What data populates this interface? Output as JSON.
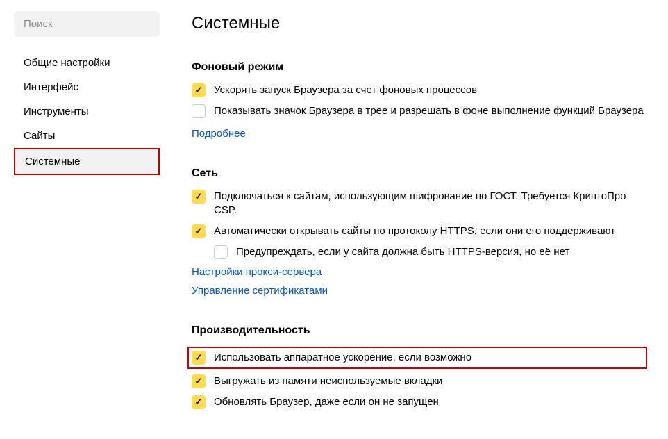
{
  "sidebar": {
    "search_placeholder": "Поиск",
    "items": [
      {
        "label": "Общие настройки"
      },
      {
        "label": "Интерфейс"
      },
      {
        "label": "Инструменты"
      },
      {
        "label": "Сайты"
      },
      {
        "label": "Системные"
      }
    ]
  },
  "page": {
    "title": "Системные"
  },
  "sections": {
    "background": {
      "title": "Фоновый режим",
      "opt1": "Ускорять запуск Браузера за счет фоновых процессов",
      "opt2": "Показывать значок Браузера в трее и разрешать в фоне выполнение функций Браузера",
      "more_link": "Подробнее"
    },
    "network": {
      "title": "Сеть",
      "opt1": "Подключаться к сайтам, использующим шифрование по ГОСТ. Требуется КриптоПро CSP.",
      "opt2": "Автоматически открывать сайты по протоколу HTTPS, если они его поддерживают",
      "opt3": "Предупреждать, если у сайта должна быть HTTPS-версия, но её нет",
      "link1": "Настройки прокси-сервера",
      "link2": "Управление сертификатами"
    },
    "performance": {
      "title": "Производительность",
      "opt1": "Использовать аппаратное ускорение, если возможно",
      "opt2": "Выгружать из памяти неиспользуемые вкладки",
      "opt3": "Обновлять Браузер, даже если он не запущен"
    }
  }
}
